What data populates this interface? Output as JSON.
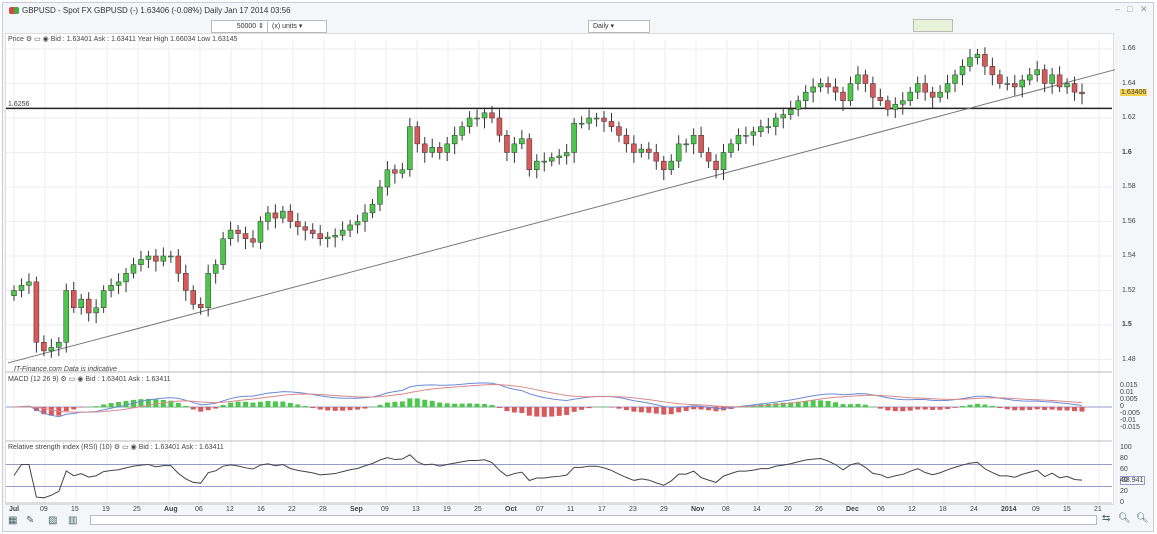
{
  "title": "GBPUSD - Spot FX GBPUSD (-)   1.63406 (-0.08%)   Daily  Jan 17 2014 03:56",
  "toolbar": {
    "quantity": "50000 ⇕",
    "units": "(x) units ▾",
    "interval": "Daily ▾"
  },
  "price_panel": {
    "header": "Price",
    "quote": "Bid : 1.63401 Ask : 1.63411 Year High 1.66034 Low 1.63145",
    "hline_label": "1.6256",
    "current": "1.63406",
    "watermark": "IT-Finance.com  Data is indicative"
  },
  "macd_panel": {
    "header": "MACD (12 26 9)",
    "quote": "Bid : 1.63401 Ask : 1.63411",
    "ticks": [
      "0.015",
      "0.01",
      "0.005",
      "0",
      "-0.005",
      "-0.01",
      "-0.015"
    ]
  },
  "rsi_panel": {
    "header": "Relative strength index (RSI) (10)",
    "quote": "Bid : 1.63401 Ask : 1.63411",
    "ticks": [
      "100",
      "80",
      "60",
      "40",
      "20",
      "0"
    ],
    "current": "38.941"
  },
  "chart_data": {
    "type": "candlestick",
    "ylim": [
      1.47,
      1.67
    ],
    "yticks": [
      "1.66",
      "1.64",
      "1.62",
      "1.6",
      "1.58",
      "1.56",
      "1.54",
      "1.52",
      "1.5",
      "1.48"
    ],
    "hline": 1.6256,
    "trendline": [
      1.478,
      1.648
    ],
    "xticks": [
      "Jul",
      "09",
      "15",
      "19",
      "25",
      "Aug",
      "06",
      "12",
      "16",
      "22",
      "28",
      "Sep",
      "09",
      "13",
      "19",
      "25",
      "Oct",
      "07",
      "11",
      "17",
      "23",
      "29",
      "Nov",
      "08",
      "14",
      "20",
      "26",
      "Dec",
      "06",
      "12",
      "18",
      "24",
      "2014",
      "09",
      "15",
      "21"
    ],
    "closes": [
      1.52,
      1.523,
      1.525,
      1.49,
      1.485,
      1.487,
      1.49,
      1.52,
      1.51,
      1.515,
      1.507,
      1.51,
      1.52,
      1.523,
      1.525,
      1.53,
      1.535,
      1.538,
      1.54,
      1.537,
      1.54,
      1.54,
      1.53,
      1.52,
      1.512,
      1.51,
      1.53,
      1.535,
      1.55,
      1.555,
      1.553,
      1.55,
      1.548,
      1.56,
      1.565,
      1.562,
      1.566,
      1.56,
      1.557,
      1.555,
      1.553,
      1.55,
      1.551,
      1.552,
      1.555,
      1.558,
      1.56,
      1.565,
      1.57,
      1.58,
      1.59,
      1.588,
      1.59,
      1.615,
      1.605,
      1.6,
      1.603,
      1.6,
      1.605,
      1.61,
      1.615,
      1.62,
      1.62,
      1.623,
      1.62,
      1.61,
      1.6,
      1.605,
      1.608,
      1.59,
      1.595,
      1.595,
      1.597,
      1.598,
      1.6,
      1.617,
      1.617,
      1.62,
      1.62,
      1.618,
      1.615,
      1.61,
      1.605,
      1.6,
      1.602,
      1.6,
      1.595,
      1.59,
      1.595,
      1.605,
      1.605,
      1.61,
      1.6,
      1.595,
      1.59,
      1.6,
      1.605,
      1.61,
      1.61,
      1.612,
      1.615,
      1.615,
      1.62,
      1.622,
      1.625,
      1.63,
      1.635,
      1.638,
      1.64,
      1.638,
      1.635,
      1.63,
      1.64,
      1.645,
      1.64,
      1.632,
      1.63,
      1.625,
      1.628,
      1.63,
      1.635,
      1.64,
      1.635,
      1.632,
      1.635,
      1.64,
      1.645,
      1.65,
      1.655,
      1.657,
      1.65,
      1.645,
      1.64,
      1.64,
      1.638,
      1.642,
      1.645,
      1.648,
      1.64,
      1.645,
      1.638,
      1.64,
      1.635,
      1.634
    ],
    "colors": {
      "up": "#4cc74c",
      "down": "#d9585a"
    }
  }
}
